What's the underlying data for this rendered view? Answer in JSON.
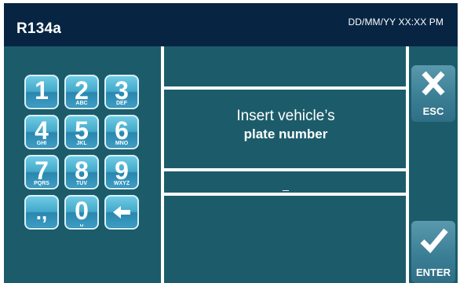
{
  "header": {
    "title": "R134a",
    "datetime": "DD/MM/YY XX:XX PM"
  },
  "keypad": {
    "keys": [
      {
        "digit": "1",
        "letters": ""
      },
      {
        "digit": "2",
        "letters": "ABC"
      },
      {
        "digit": "3",
        "letters": "DEF"
      },
      {
        "digit": "4",
        "letters": "GHI"
      },
      {
        "digit": "5",
        "letters": "JKL"
      },
      {
        "digit": "6",
        "letters": "MNO"
      },
      {
        "digit": "7",
        "letters": "PQRS"
      },
      {
        "digit": "8",
        "letters": "TUV"
      },
      {
        "digit": "9",
        "letters": "WXYZ"
      },
      {
        "digit": ".,",
        "letters": ""
      },
      {
        "digit": "0",
        "letters": "␣"
      },
      {
        "icon": "arrow-left-icon"
      }
    ]
  },
  "prompt": {
    "line1": "Insert vehicle’s",
    "line2": "plate number"
  },
  "input": {
    "value": "_"
  },
  "buttons": {
    "esc": "ESC",
    "enter": "ENTER"
  },
  "colors": {
    "titlebar": "#072543",
    "panel": "#1c5c6a",
    "key": "#43a9cb"
  }
}
